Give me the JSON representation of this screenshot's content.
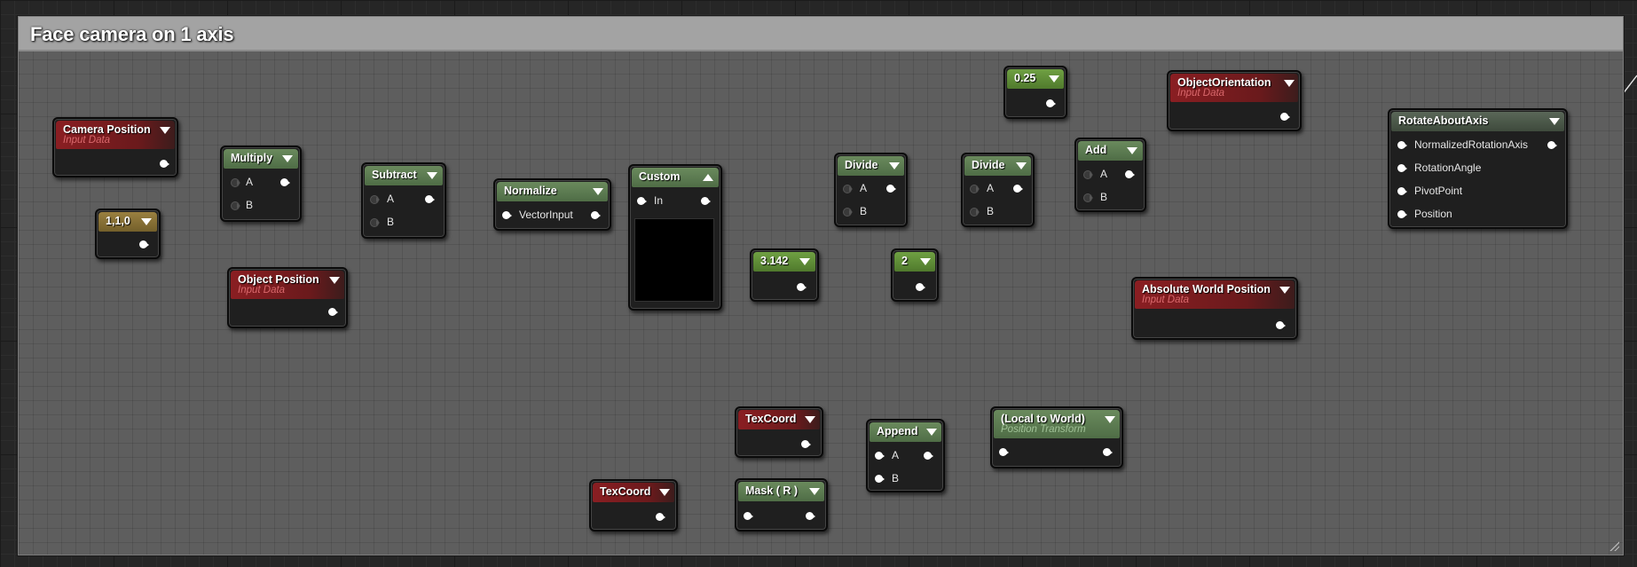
{
  "comment_title": "Face camera on 1 axis",
  "colors": {
    "param_red": "#8a1e22",
    "math_green": "#4f6d46",
    "const_gold": "#74602b",
    "const_lime": "#507a2d",
    "wire": "#e8e8e8"
  },
  "nodes": {
    "camera_position": {
      "title": "Camera Position",
      "subtitle": "Input Data"
    },
    "const_110": {
      "title": "1,1,0"
    },
    "multiply": {
      "title": "Multiply",
      "a": "A",
      "b": "B"
    },
    "object_position": {
      "title": "Object Position",
      "subtitle": "Input Data"
    },
    "subtract": {
      "title": "Subtract",
      "a": "A",
      "b": "B"
    },
    "normalize": {
      "title": "Normalize",
      "input": "VectorInput"
    },
    "custom": {
      "title": "Custom",
      "input": "In"
    },
    "pi": {
      "title": "3.142"
    },
    "divide1": {
      "title": "Divide",
      "a": "A",
      "b": "B"
    },
    "two": {
      "title": "2"
    },
    "divide2": {
      "title": "Divide",
      "a": "A",
      "b": "B"
    },
    "quarter": {
      "title": "0.25"
    },
    "add": {
      "title": "Add",
      "a": "A",
      "b": "B"
    },
    "object_orientation": {
      "title": "ObjectOrientation",
      "subtitle": "Input Data"
    },
    "rotate_about_axis": {
      "title": "RotateAboutAxis",
      "pins": [
        "NormalizedRotationAxis",
        "RotationAngle",
        "PivotPoint",
        "Position"
      ]
    },
    "absolute_world_position": {
      "title": "Absolute World Position",
      "subtitle": "Input Data"
    },
    "texcoord1": {
      "title": "TexCoord"
    },
    "append": {
      "title": "Append",
      "a": "A",
      "b": "B"
    },
    "local_to_world": {
      "title": "(Local to World)",
      "subtitle": "Position Transform"
    },
    "texcoord2": {
      "title": "TexCoord"
    },
    "mask": {
      "title": "Mask ( R )"
    }
  }
}
